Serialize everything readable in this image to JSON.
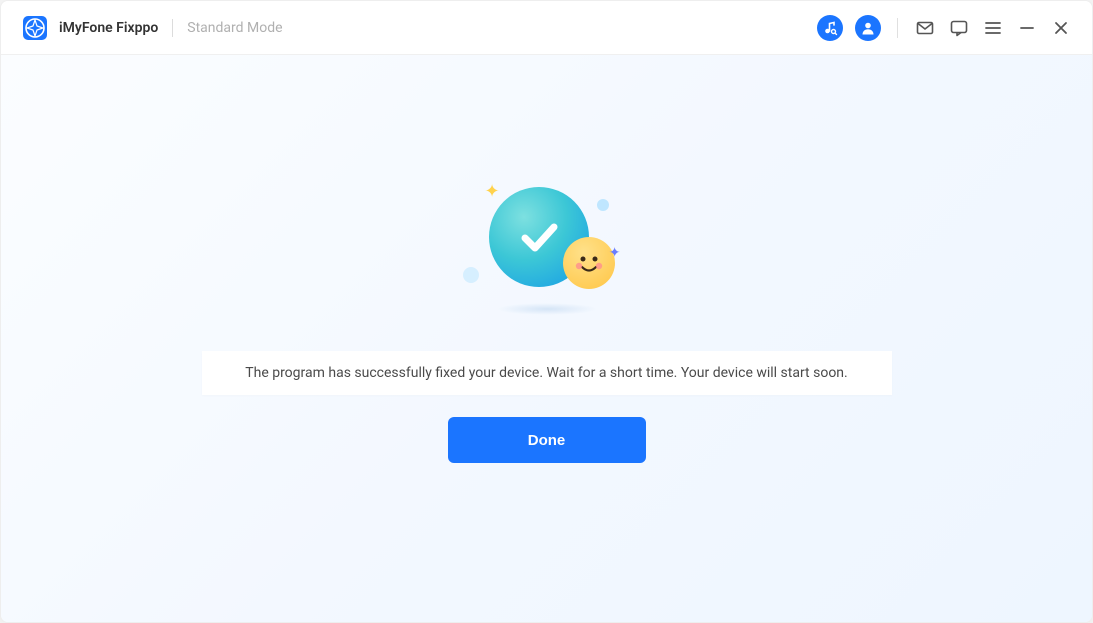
{
  "app": {
    "title": "iMyFone Fixppo",
    "mode": "Standard Mode"
  },
  "icons": {
    "music": "music-search-icon",
    "account": "account-icon",
    "mail": "mail-icon",
    "chat": "chat-icon",
    "menu": "menu-icon",
    "minimize": "minimize-icon",
    "close": "close-icon"
  },
  "content": {
    "message": "The program has successfully fixed your device. Wait for a short time. Your device will start soon.",
    "done_label": "Done"
  },
  "colors": {
    "accent": "#1b75ff"
  }
}
